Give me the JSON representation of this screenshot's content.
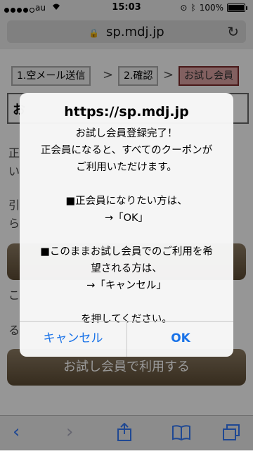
{
  "status_bar": {
    "carrier": "au",
    "time": "15:03",
    "battery": "100%"
  },
  "address_bar": {
    "url": "sp.mdj.jp"
  },
  "page": {
    "steps": [
      "1.空メール送信",
      "2.確認",
      "お試し会員"
    ],
    "step_separator": ">",
    "header_fragment": "お",
    "text_frag_1": "正",
    "text_frag_2": "い",
    "text_frag_3": "引",
    "text_frag_4": "ら",
    "text_frag_5": "こ",
    "text_frag_6": "る",
    "bottom_button": "お試し会員で利用する"
  },
  "alert": {
    "title": "https://sp.mdj.jp",
    "message": "お試し会員登録完了！\n正会員になると、すべてのクーポンが\nご利用いただけます。\n\n■正会員になりたい方は、\n→「OK」\n\n■このままお試し会員でのご利用を希\n望される方は、\n→「キャンセル」\n\nを押してください。",
    "cancel_label": "キャンセル",
    "ok_label": "OK"
  },
  "colors": {
    "accent": "#1a73e8",
    "active_step": "#d9a0a0",
    "button_brown": "#6b5a43"
  }
}
